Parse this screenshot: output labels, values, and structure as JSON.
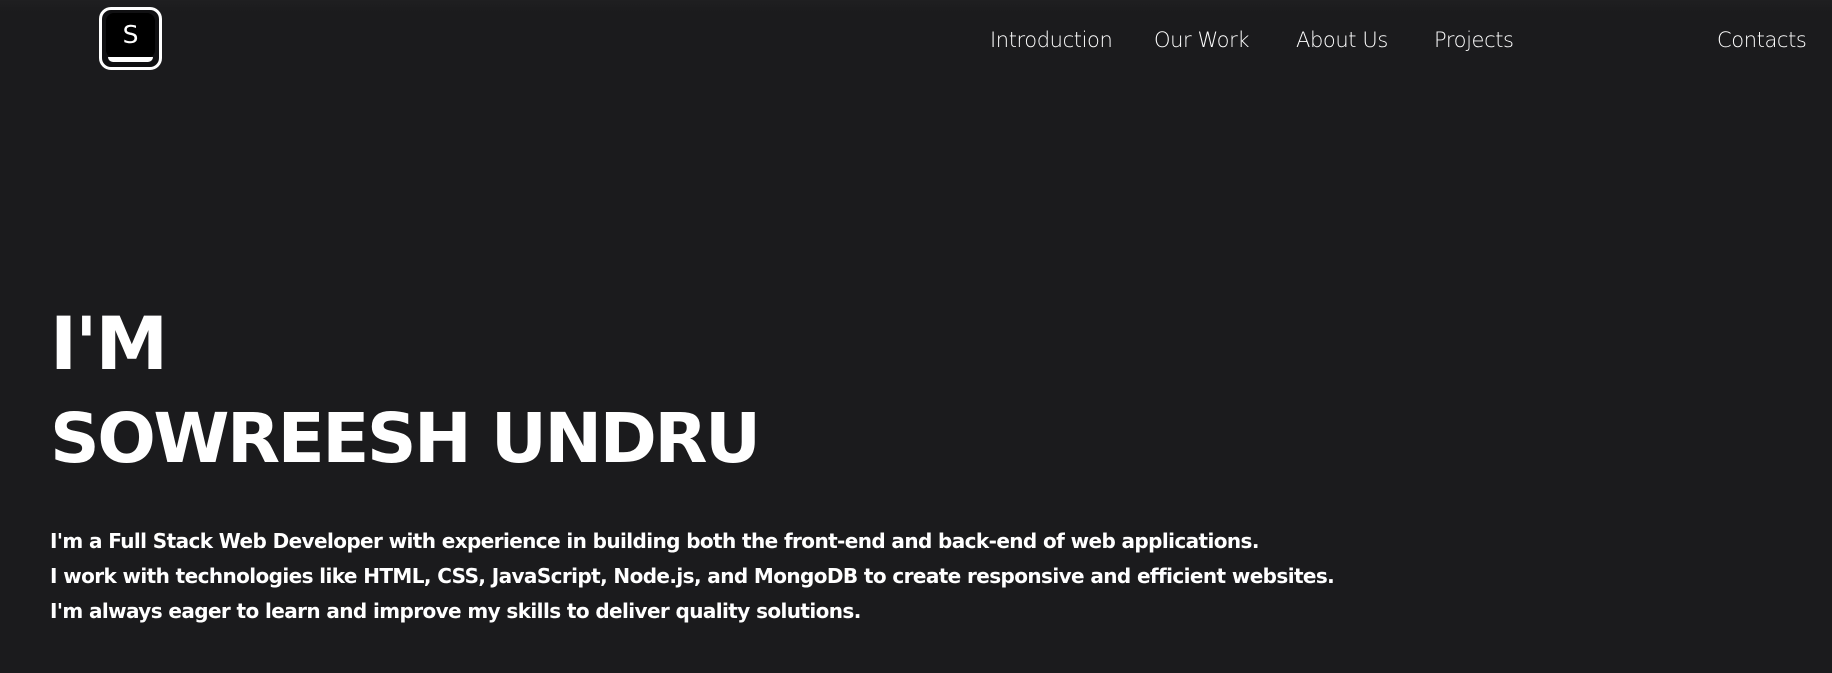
{
  "colors": {
    "background": "#1b1b1d",
    "text": "#ffffff",
    "logo_fill": "#000000"
  },
  "logo": {
    "letter": "S",
    "icon": "s-logo-icon"
  },
  "nav": {
    "links": [
      {
        "label": "Introduction"
      },
      {
        "label": "Our Work"
      },
      {
        "label": "About Us"
      },
      {
        "label": "Projects"
      },
      {
        "label": "Contacts"
      }
    ]
  },
  "hero": {
    "greeting": "I'M",
    "name": "SOWREESH UNDRU",
    "bio": [
      "I'm a Full Stack Web Developer with experience in building both the front-end and back-end of web applications.",
      "I work with technologies like HTML, CSS, JavaScript, Node.js, and MongoDB to create responsive and efficient websites.",
      "I'm always eager to learn and improve my skills to deliver quality solutions."
    ]
  }
}
